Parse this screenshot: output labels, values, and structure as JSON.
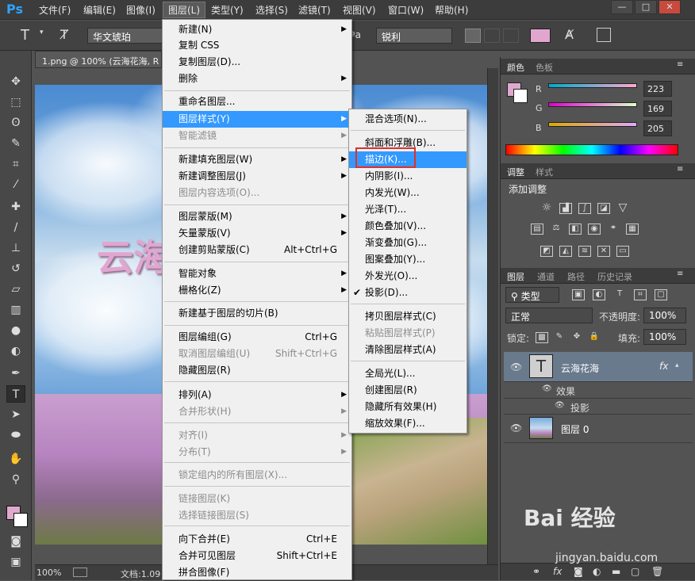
{
  "app": {
    "logo": "Ps"
  },
  "menubar": {
    "items": [
      "文件(F)",
      "编辑(E)",
      "图像(I)",
      "图层(L)",
      "类型(Y)",
      "选择(S)",
      "滤镜(T)",
      "视图(V)",
      "窗口(W)",
      "帮助(H)"
    ],
    "active_index": 3
  },
  "window_controls": [
    "—",
    "□",
    "✕"
  ],
  "options": {
    "font_family": "华文琥珀",
    "aa_label": "ªa",
    "aa_value": "锐利",
    "text_color": "#e1a6cf"
  },
  "document": {
    "tab_title": "1.png @ 100% (云海花海, R",
    "canvas_text": "云海",
    "zoom": "100%",
    "doc_info": "文档:1.09"
  },
  "layer_menu": {
    "items": [
      {
        "label": "新建(N)",
        "arrow": true
      },
      {
        "label": "复制 CSS"
      },
      {
        "label": "复制图层(D)..."
      },
      {
        "label": "删除",
        "arrow": true
      },
      {
        "label": "重命名图层..."
      },
      {
        "label": "图层样式(Y)",
        "arrow": true,
        "highlight": true
      },
      {
        "label": "智能滤镜",
        "arrow": true,
        "disabled": true
      },
      {
        "label": "新建填充图层(W)",
        "arrow": true
      },
      {
        "label": "新建调整图层(J)",
        "arrow": true
      },
      {
        "label": "图层内容选项(O)...",
        "disabled": true
      },
      {
        "label": "图层蒙版(M)",
        "arrow": true
      },
      {
        "label": "矢量蒙版(V)",
        "arrow": true
      },
      {
        "label": "创建剪贴蒙版(C)",
        "shortcut": "Alt+Ctrl+G"
      },
      {
        "label": "智能对象",
        "arrow": true
      },
      {
        "label": "栅格化(Z)",
        "arrow": true
      },
      {
        "label": "新建基于图层的切片(B)"
      },
      {
        "label": "图层编组(G)",
        "shortcut": "Ctrl+G"
      },
      {
        "label": "取消图层编组(U)",
        "shortcut": "Shift+Ctrl+G",
        "disabled": true
      },
      {
        "label": "隐藏图层(R)"
      },
      {
        "label": "排列(A)",
        "arrow": true
      },
      {
        "label": "合并形状(H)",
        "arrow": true,
        "disabled": true
      },
      {
        "label": "对齐(I)",
        "arrow": true,
        "disabled": true
      },
      {
        "label": "分布(T)",
        "arrow": true,
        "disabled": true
      },
      {
        "label": "锁定组内的所有图层(X)...",
        "disabled": true
      },
      {
        "label": "链接图层(K)",
        "disabled": true
      },
      {
        "label": "选择链接图层(S)",
        "disabled": true
      },
      {
        "label": "向下合并(E)",
        "shortcut": "Ctrl+E"
      },
      {
        "label": "合并可见图层",
        "shortcut": "Shift+Ctrl+E"
      },
      {
        "label": "拼合图像(F)"
      }
    ]
  },
  "style_menu": {
    "items": [
      {
        "label": "混合选项(N)..."
      },
      {
        "label": "斜面和浮雕(B)..."
      },
      {
        "label": "描边(K)...",
        "highlight": true
      },
      {
        "label": "内阴影(I)..."
      },
      {
        "label": "内发光(W)..."
      },
      {
        "label": "光泽(T)..."
      },
      {
        "label": "颜色叠加(V)..."
      },
      {
        "label": "渐变叠加(G)..."
      },
      {
        "label": "图案叠加(Y)..."
      },
      {
        "label": "外发光(O)..."
      },
      {
        "label": "投影(D)...",
        "checked": true
      },
      {
        "label": "拷贝图层样式(C)"
      },
      {
        "label": "粘贴图层样式(P)",
        "disabled": true
      },
      {
        "label": "清除图层样式(A)"
      },
      {
        "label": "全局光(L)..."
      },
      {
        "label": "创建图层(R)"
      },
      {
        "label": "隐藏所有效果(H)"
      },
      {
        "label": "缩放效果(F)..."
      }
    ]
  },
  "color_panel": {
    "tabs": [
      "颜色",
      "色板"
    ],
    "channels": [
      {
        "name": "R",
        "value": "223"
      },
      {
        "name": "G",
        "value": "169"
      },
      {
        "name": "B",
        "value": "205"
      }
    ],
    "fg_color": "#dfa9cd"
  },
  "adjust_panel": {
    "tabs": [
      "调整",
      "样式"
    ],
    "title": "添加调整"
  },
  "layers_panel": {
    "tabs": [
      "图层",
      "通道",
      "路径",
      "历史记录"
    ],
    "filter": "类型",
    "blend_mode": "正常",
    "opacity_label": "不透明度:",
    "opacity": "100%",
    "lock_label": "锁定:",
    "fill_label": "填充:",
    "fill": "100%",
    "layers": [
      {
        "name": "云海花海",
        "type": "text",
        "fx": "fx",
        "effects_label": "效果",
        "effects": [
          "投影"
        ]
      },
      {
        "name": "图层 0",
        "type": "image"
      }
    ]
  },
  "watermark": {
    "brand": "Bai 经验",
    "url": "jingyan.baidu.com"
  }
}
